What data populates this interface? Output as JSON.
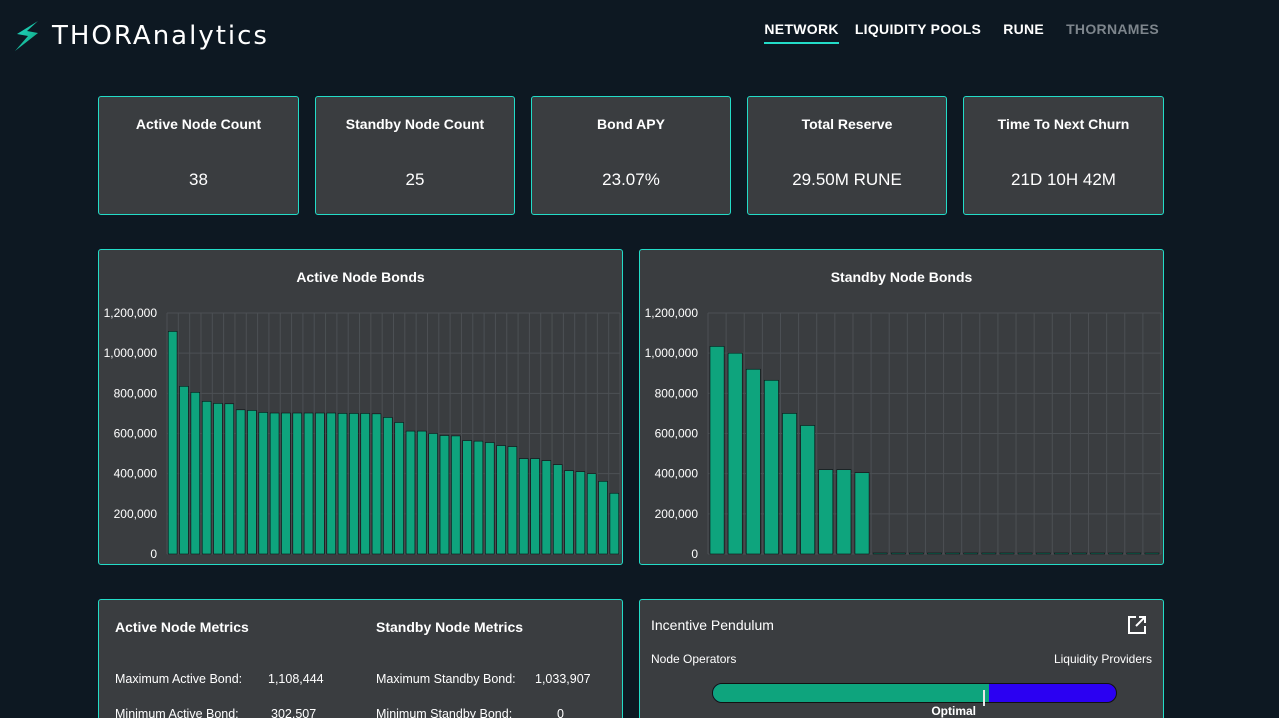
{
  "header": {
    "brand": "THORAnalytics",
    "nav": [
      {
        "label": "NETWORK",
        "active": true
      },
      {
        "label": "LIQUIDITY POOLS",
        "active": false
      },
      {
        "label": "RUNE",
        "active": false
      },
      {
        "label": "THORNAMES",
        "active": false
      }
    ]
  },
  "stats": [
    {
      "title": "Active Node Count",
      "value": "38"
    },
    {
      "title": "Standby Node Count",
      "value": "25"
    },
    {
      "title": "Bond APY",
      "value": "23.07%"
    },
    {
      "title": "Total Reserve",
      "value": "29.50M RUNE"
    },
    {
      "title": "Time To Next Churn",
      "value": "21D 10H 42M"
    }
  ],
  "colors": {
    "accent": "#23dcc8",
    "bar": "#0ea47d",
    "panel": "#3a3d40",
    "background": "#0d1822",
    "pendulum_lp": "#2b00f2"
  },
  "chart_data": [
    {
      "type": "bar",
      "title": "Active Node Bonds",
      "ylim": [
        0,
        1200000
      ],
      "yticks": [
        "0",
        "200,000",
        "400,000",
        "600,000",
        "800,000",
        "1,000,000",
        "1,200,000"
      ],
      "grid": true,
      "values": [
        1108444,
        835000,
        805000,
        760000,
        750000,
        748000,
        718000,
        715000,
        705000,
        702000,
        702000,
        702000,
        702000,
        702000,
        702000,
        700000,
        700000,
        700000,
        698000,
        680000,
        655000,
        612000,
        612000,
        600000,
        590000,
        588000,
        565000,
        562000,
        555000,
        540000,
        535000,
        475000,
        475000,
        465000,
        445000,
        415000,
        410000,
        400000,
        362000,
        302507
      ]
    },
    {
      "type": "bar",
      "title": "Standby Node Bonds",
      "ylim": [
        0,
        1200000
      ],
      "yticks": [
        "0",
        "200,000",
        "400,000",
        "600,000",
        "800,000",
        "1,000,000",
        "1,200,000"
      ],
      "grid": true,
      "values": [
        1033907,
        1000000,
        920000,
        865000,
        700000,
        640000,
        420000,
        420000,
        405000,
        0,
        0,
        0,
        0,
        0,
        0,
        0,
        0,
        0,
        0,
        0,
        0,
        0,
        0,
        0,
        0
      ]
    }
  ],
  "metrics": {
    "active_title": "Active Node Metrics",
    "standby_title": "Standby Node Metrics",
    "active": [
      {
        "label": "Maximum Active Bond:",
        "value": "1,108,444"
      },
      {
        "label": "Minimum Active Bond:",
        "value": "302,507"
      }
    ],
    "standby": [
      {
        "label": "Maximum Standby Bond:",
        "value": "1,033,907"
      },
      {
        "label": "Minimum Standby Bond:",
        "value": "0"
      }
    ]
  },
  "pendulum": {
    "title": "Incentive Pendulum",
    "left_label": "Node Operators",
    "right_label": "Liquidity Providers",
    "optimal_label": "Optimal",
    "node_share": 0.685,
    "optimal_position": 0.67,
    "external_icon": "external-link-icon"
  }
}
